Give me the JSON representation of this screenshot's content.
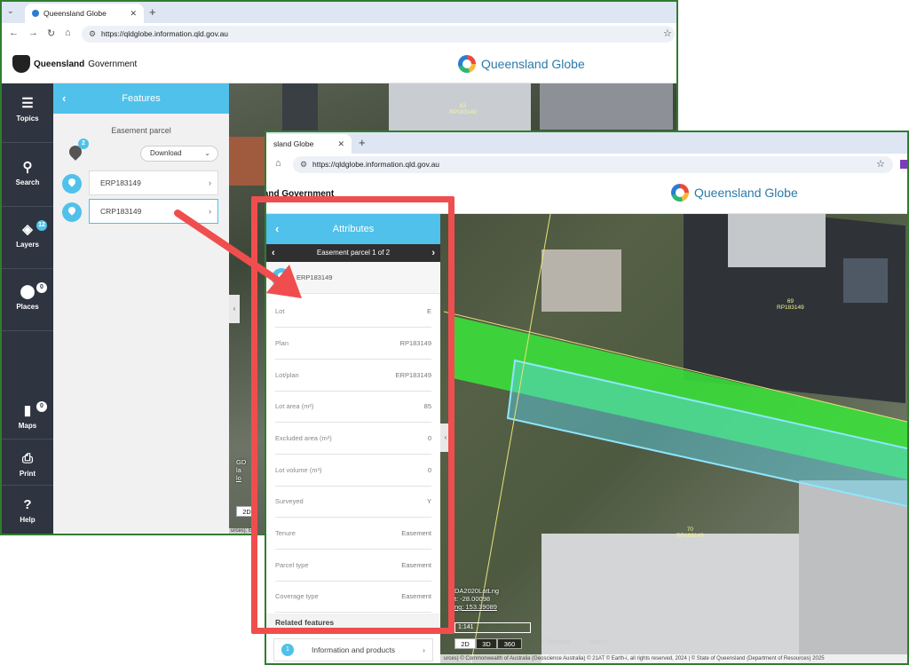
{
  "browser": {
    "tab_title": "Queensland Globe",
    "tab2_title_partial": "sland Globe",
    "url": "https://qldglobe.information.qld.gov.au"
  },
  "header": {
    "gov_bold": "Queensland",
    "gov_rest": "Government",
    "gov_partial": "land Government",
    "app_name": "Queensland Globe"
  },
  "sidebar": {
    "items": [
      {
        "label": "Topics",
        "icon": "topics-icon"
      },
      {
        "label": "Search",
        "icon": "search-icon"
      },
      {
        "label": "Layers",
        "icon": "layers-icon",
        "badge": "12"
      },
      {
        "label": "Places",
        "icon": "place-pin-icon",
        "badge": "0"
      },
      {
        "label": "Maps",
        "icon": "map-icon",
        "badge": "0"
      },
      {
        "label": "Print",
        "icon": "printer-icon"
      },
      {
        "label": "Help",
        "icon": "help-icon"
      }
    ]
  },
  "features_panel": {
    "title": "Features",
    "subtitle": "Easement parcel",
    "add_badge": "2",
    "download_label": "Download",
    "items": [
      {
        "label": "ERP183149"
      },
      {
        "label": "CRP183149"
      }
    ]
  },
  "map1": {
    "lot_label_1": "63",
    "lot_plan_1": "RP183149",
    "partial_coords_1": "GD",
    "partial_coords_2": "la",
    "partial_coords_3": "lo",
    "dim_2d": "2D",
    "credit_partial": "urces); Ea"
  },
  "attributes_panel": {
    "title": "Attributes",
    "pager_label": "Easement parcel 1 of 2",
    "feature_id": "ERP183149",
    "rows": [
      {
        "key": "Lot",
        "value": "E"
      },
      {
        "key": "Plan",
        "value": "RP183149"
      },
      {
        "key": "Lot/plan",
        "value": "ERP183149"
      },
      {
        "key": "Lot area (m²)",
        "value": "85"
      },
      {
        "key": "Excluded area (m²)",
        "value": "0"
      },
      {
        "key": "Lot volume (m³)",
        "value": "0"
      },
      {
        "key": "Surveyed",
        "value": "Y"
      },
      {
        "key": "Tenure",
        "value": "Easement"
      },
      {
        "key": "Parcel type",
        "value": "Easement"
      },
      {
        "key": "Coverage type",
        "value": "Easement"
      }
    ],
    "related_heading": "Related features",
    "info_products": {
      "count": "1",
      "label": "Information and products"
    }
  },
  "map2": {
    "lot_num_top": "69",
    "lot_plan_top": "RP183149",
    "lot_num_bottom": "70",
    "lot_plan_bottom": "RP183149",
    "coord_datum": "DA2020LatLng",
    "coord_lat": "t: -28.00098",
    "coord_lng": "ng: 153.39089",
    "scale": "1:141",
    "dim_buttons": [
      "2D",
      "3D",
      "360"
    ],
    "prev_label": "< Previous",
    "next_label": "Next >",
    "credit": "urces) © Commonwealth of Australia (Geoscience Australia) © 21AT © Earth-i, all rights reserved, 2024 | © State of Queensland (Department of Resources) 2025"
  },
  "colors": {
    "panel_accent": "#4fc1ea",
    "nav_dark": "#2e3440",
    "highlight_box": "#f04e4e",
    "easement_fill": "#39e639",
    "window_border": "#2f7d2f"
  }
}
